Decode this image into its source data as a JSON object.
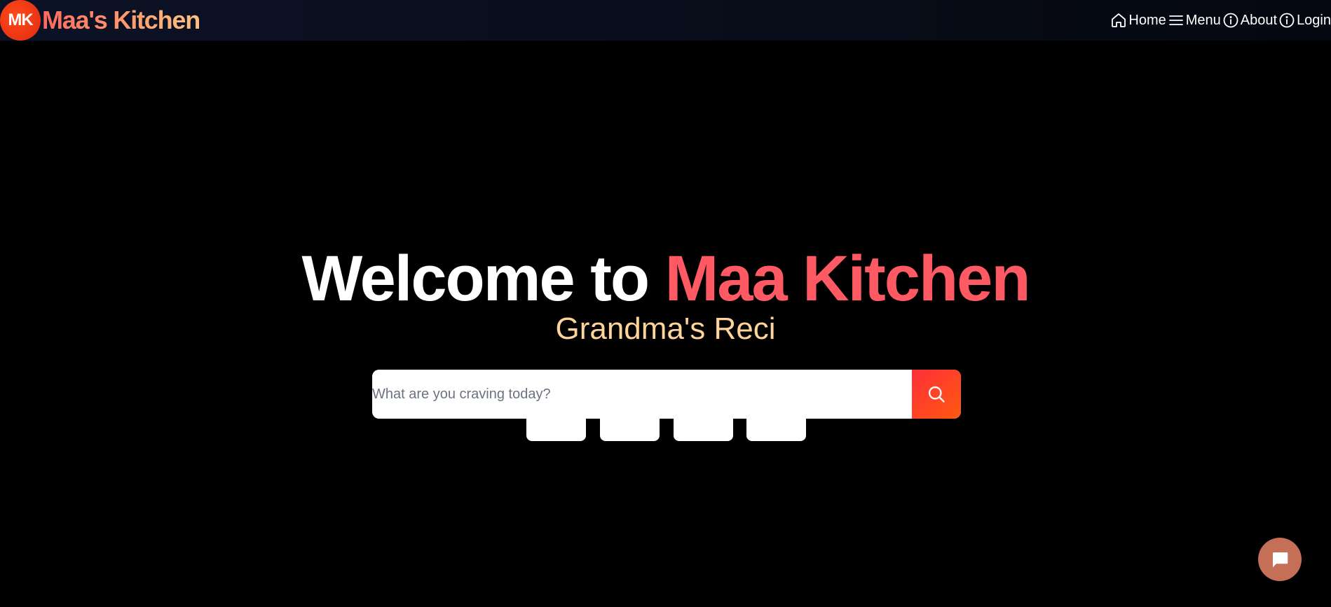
{
  "brand": {
    "badge": "MK",
    "name": "Maa's Kitchen"
  },
  "nav": {
    "items": [
      {
        "label": "Home",
        "icon": "home-icon"
      },
      {
        "label": "Menu",
        "icon": "menu-icon"
      },
      {
        "label": "About",
        "icon": "info-icon"
      },
      {
        "label": "Login",
        "icon": "info-icon"
      }
    ]
  },
  "hero": {
    "title_prefix": "Welcome to ",
    "title_accent": "Maa Kitchen",
    "subtitle": "Grandma's Reci"
  },
  "search": {
    "placeholder": "What are you craving today?",
    "value": "",
    "button_icon": "search-icon"
  },
  "chips": [
    "",
    "",
    "",
    ""
  ],
  "chat": {
    "icon": "chat-bubble-icon"
  },
  "colors": {
    "accent": "#ff5a64",
    "subtitle": "#ffd49a",
    "search_button": "#ff3c28",
    "chat_button": "#c46f56",
    "badge": "#e8321a"
  }
}
